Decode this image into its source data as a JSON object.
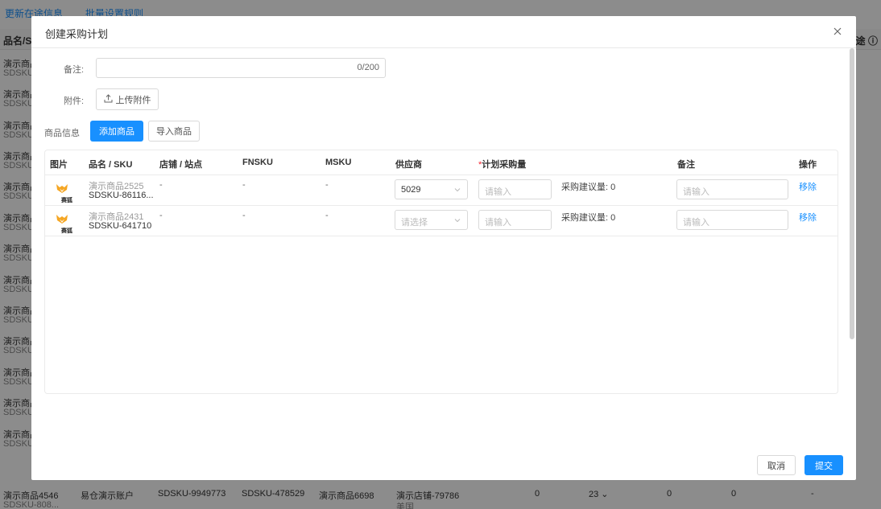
{
  "background": {
    "links": [
      "更新在途信息",
      "批量设置规则"
    ],
    "header_first": "品名/SKU",
    "header_last": "在途 ⓘ",
    "rows": [
      {
        "name": "演示商品",
        "sku": "SDSKU-"
      },
      {
        "name": "演示商品",
        "sku": "SDSKU-"
      },
      {
        "name": "演示商品",
        "sku": "SDSKU-"
      },
      {
        "name": "演示商品",
        "sku": "SDSKU-"
      },
      {
        "name": "演示商品",
        "sku": "SDSKU-"
      },
      {
        "name": "演示商品",
        "sku": "SDSKU-"
      },
      {
        "name": "演示商品",
        "sku": "SDSKU-"
      },
      {
        "name": "演示商品",
        "sku": "SDSKU-"
      },
      {
        "name": "演示商品",
        "sku": "SDSKU-"
      },
      {
        "name": "演示商品",
        "sku": "SDSKU-"
      },
      {
        "name": "演示商品",
        "sku": "SDSKU-"
      },
      {
        "name": "演示商品",
        "sku": "SDSKU-"
      },
      {
        "name": "演示商品",
        "sku": "SDSKU-"
      }
    ],
    "bottom_row": {
      "name": "演示商品4546",
      "sku": "SDSKU-808...",
      "account": "易仓演示账户",
      "sku2": "SDSKU-9949773",
      "sku3": "SDSKU-478529",
      "product": "演示商品6698",
      "store": "演示店铺-79786",
      "region": "美国",
      "v1": "0",
      "v2": "23 ⌄",
      "v3": "0",
      "v4": "0",
      "v5": "-"
    }
  },
  "modal": {
    "title": "创建采购计划",
    "remark_label": "备注:",
    "remark_count": "0/200",
    "attachment_label": "附件:",
    "upload_label": "上传附件",
    "product_info_label": "商品信息",
    "add_product_label": "添加商品",
    "import_product_label": "导入商品",
    "table": {
      "headers": [
        "图片",
        "品名 / SKU",
        "店铺 / 站点",
        "FNSKU",
        "MSKU",
        "供应商",
        "计划采购量",
        "备注",
        "操作"
      ],
      "required_mark": "*",
      "rows": [
        {
          "image_text": "赛狐",
          "name": "演示商品2525",
          "sku": "SDSKU-86116...",
          "store": "-",
          "fnsku": "-",
          "msku": "-",
          "supplier": "5029",
          "supplier_is_placeholder": false,
          "qty_placeholder": "请输入",
          "suggest_label": "采购建议量:",
          "suggest_value": "0",
          "remark_placeholder": "请输入",
          "action": "移除"
        },
        {
          "image_text": "赛狐",
          "name": "演示商品2431",
          "sku": "SDSKU-641710",
          "store": "-",
          "fnsku": "-",
          "msku": "-",
          "supplier": "请选择",
          "supplier_is_placeholder": true,
          "qty_placeholder": "请输入",
          "suggest_label": "采购建议量:",
          "suggest_value": "0",
          "remark_placeholder": "请输入",
          "action": "移除"
        }
      ]
    },
    "cancel_label": "取消",
    "submit_label": "提交"
  },
  "colors": {
    "primary": "#1890ff",
    "required": "#f5222d",
    "overlay": "rgba(0,0,0,0.45)"
  },
  "icons": [
    "close-icon",
    "upload-icon",
    "chevron-down-icon",
    "product-logo-icon"
  ]
}
